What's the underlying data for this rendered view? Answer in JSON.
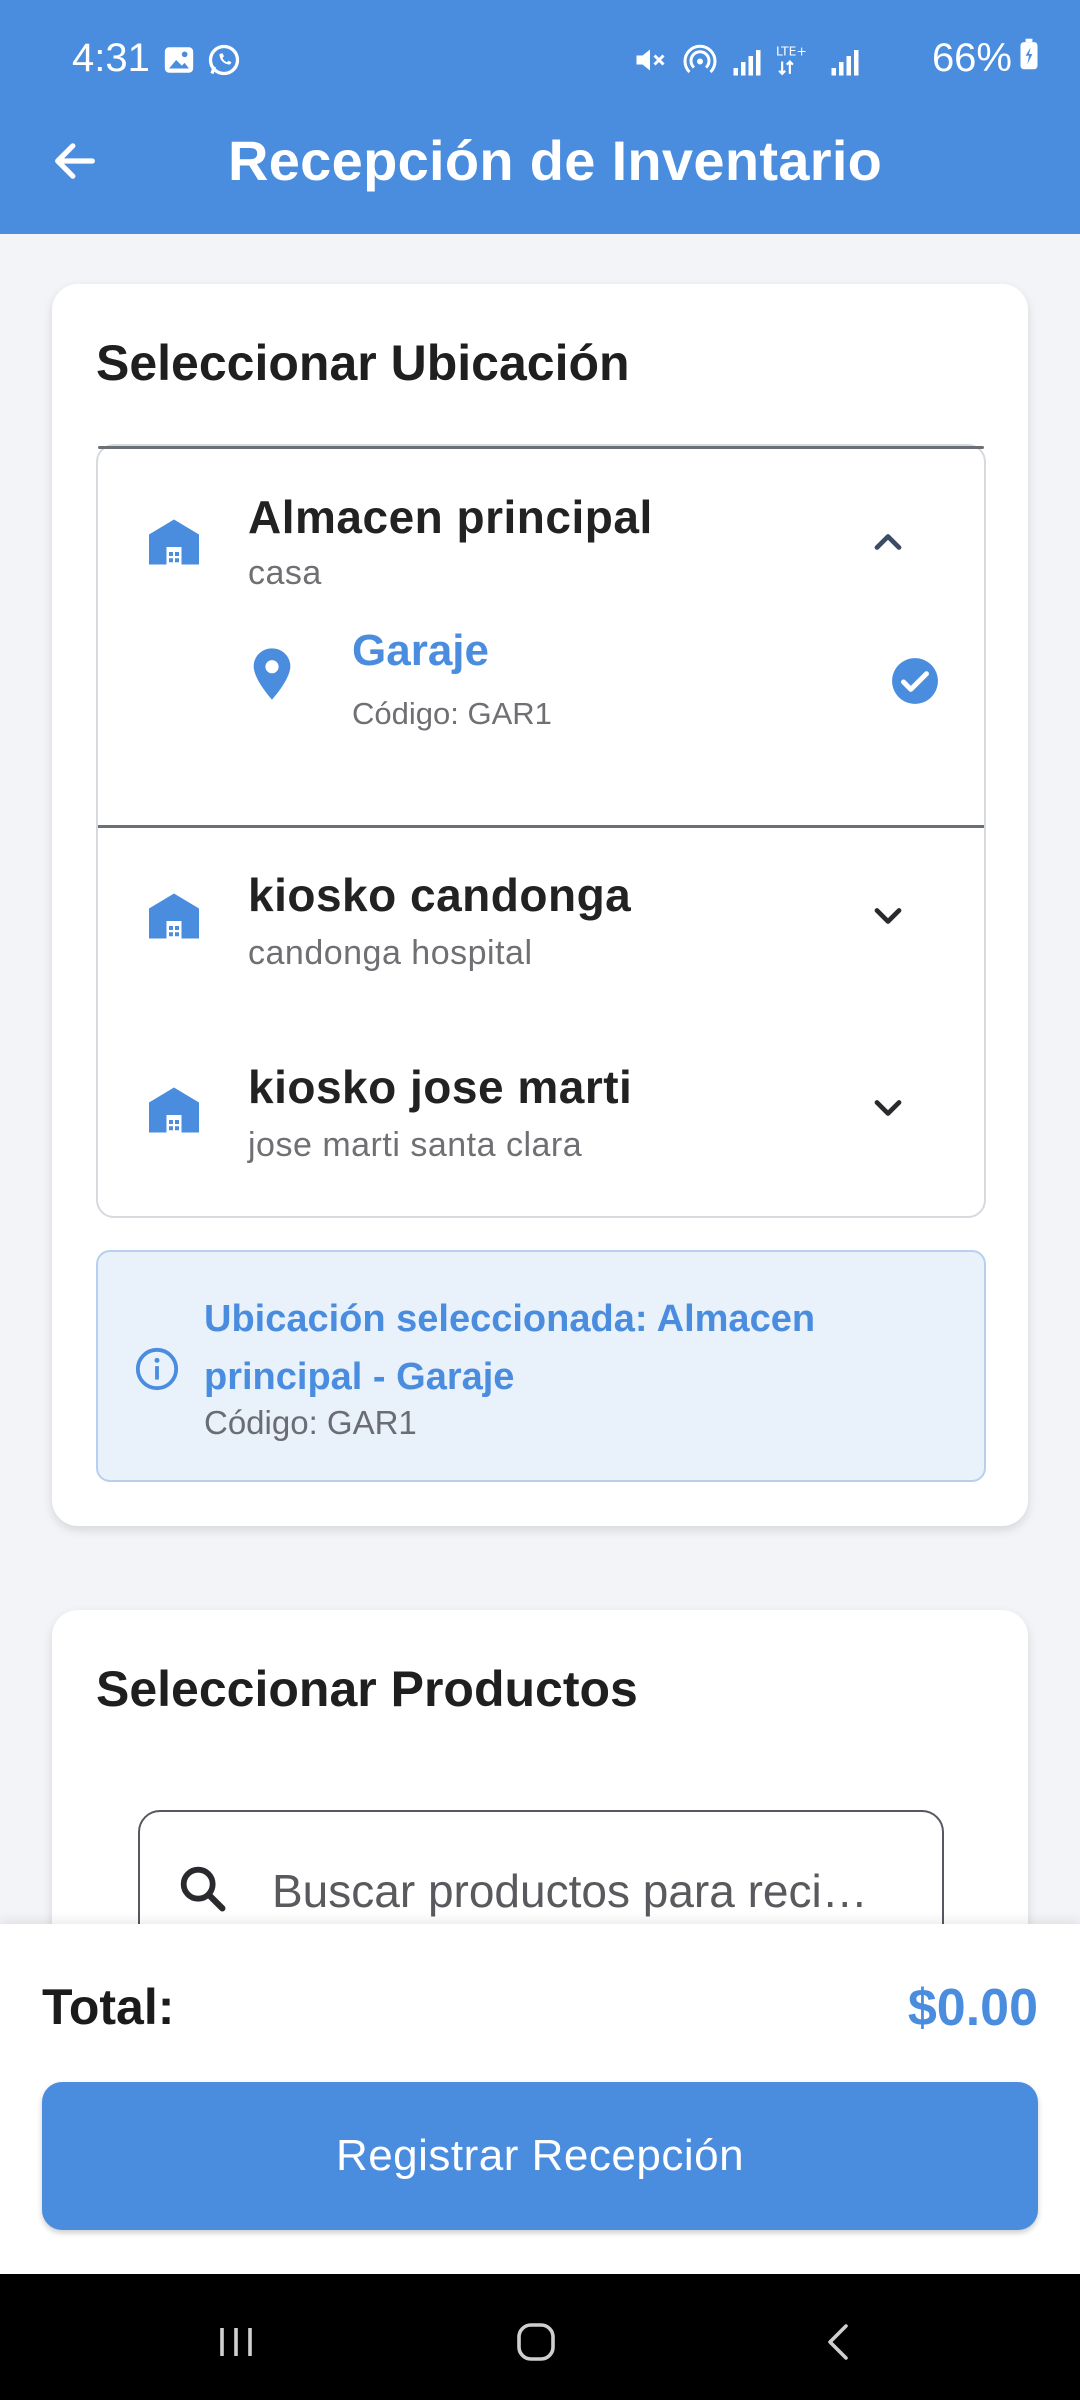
{
  "status_bar": {
    "time": "4:31",
    "battery": "66%",
    "left_icons": [
      "gallery-icon",
      "whatsapp-icon"
    ],
    "right_icons": [
      "mute-icon",
      "hotspot-icon",
      "signal-icon",
      "lte-signal-icon",
      "signal-icon"
    ]
  },
  "app_bar": {
    "title": "Recepción de Inventario",
    "color": "#4a8ddf"
  },
  "location_card": {
    "title": "Seleccionar Ubicación",
    "locations": [
      {
        "name": "Almacen principal",
        "subtitle": "casa",
        "expanded": true,
        "sublocations": [
          {
            "name": "Garaje",
            "code": "Código: GAR1",
            "selected": true
          }
        ]
      },
      {
        "name": "kiosko candonga",
        "subtitle": "candonga hospital",
        "expanded": false
      },
      {
        "name": "kiosko jose marti",
        "subtitle": "jose marti santa clara",
        "expanded": false
      }
    ],
    "selected_info": {
      "text": "Ubicación seleccionada: Almacen principal - Garaje",
      "code": "Código: GAR1"
    }
  },
  "products_card": {
    "title": "Seleccionar Productos",
    "search_placeholder": "Buscar productos para reci…"
  },
  "footer": {
    "total_label": "Total:",
    "total_value": "$0.00",
    "register_button": "Registrar Recepción"
  },
  "nav_bar": {
    "icons": [
      "recents-icon",
      "home-icon",
      "back-nav-icon"
    ]
  }
}
